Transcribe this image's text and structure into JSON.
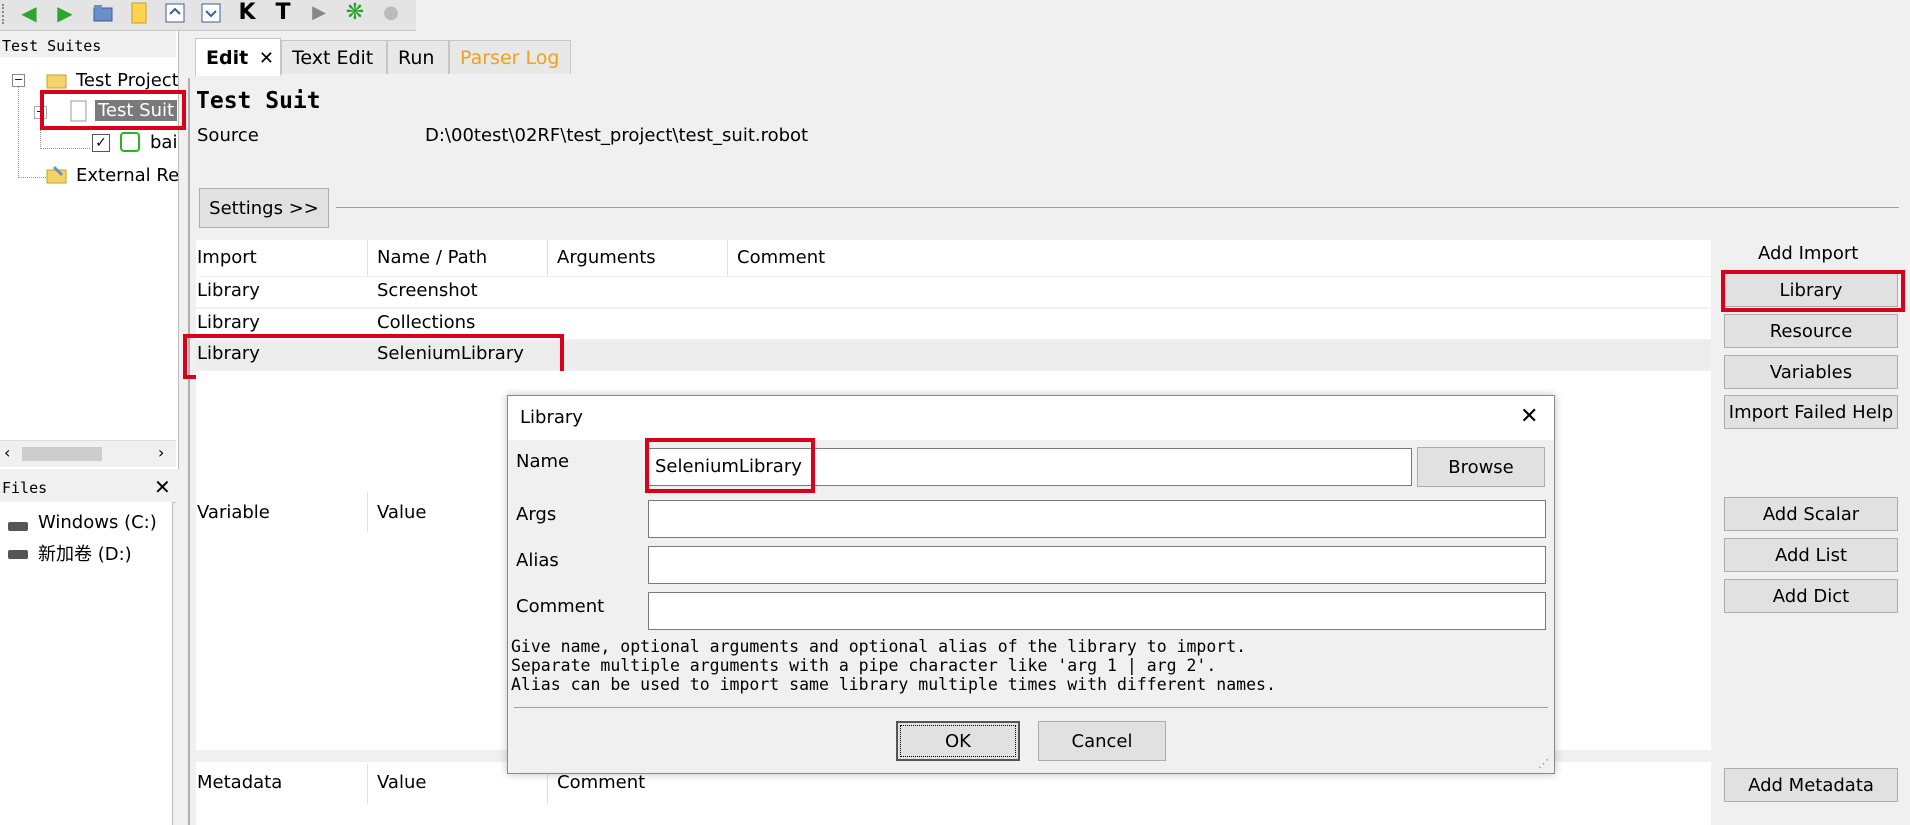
{
  "toolbar": {
    "icons": [
      "back-arrow-icon",
      "forward-arrow-icon",
      "open-folder-icon",
      "new-file-icon",
      "save-icon",
      "save-all-icon",
      "search-keywords-icon",
      "search-tests-icon",
      "run-icon",
      "debug-icon",
      "stop-icon"
    ],
    "k_glyph": "K",
    "t_glyph": "T"
  },
  "tree": {
    "title": "Test Suites",
    "project": "Test Project",
    "suite": "Test Suit",
    "test_case": "bai",
    "external": "External Resources"
  },
  "files": {
    "title": "Files",
    "drives": [
      "Windows (C:)",
      "新加卷 (D:)"
    ]
  },
  "tabs": [
    "Edit",
    "Text Edit",
    "Run",
    "Parser Log"
  ],
  "colors": {
    "accent_red": "#d9001b",
    "parser_log_tab": "#f0a020",
    "test_case_icon": "#26b526"
  },
  "editor": {
    "title": "Test Suit",
    "source_label": "Source",
    "source_path": "D:\\00test\\02RF\\test_project\\test_suit.robot",
    "settings_button": "Settings >>",
    "imports": {
      "headers": [
        "Import",
        "Name / Path",
        "Arguments",
        "Comment"
      ],
      "rows": [
        {
          "type": "Library",
          "name": "Screenshot"
        },
        {
          "type": "Library",
          "name": "Collections"
        },
        {
          "type": "Library",
          "name": "SeleniumLibrary"
        }
      ]
    },
    "add_import": {
      "label": "Add Import",
      "library": "Library",
      "resource": "Resource",
      "variables": "Variables",
      "import_failed_help": "Import Failed Help"
    },
    "variables": {
      "headers": [
        "Variable",
        "Value"
      ],
      "add_scalar": "Add Scalar",
      "add_list": "Add List",
      "add_dict": "Add Dict"
    },
    "metadata": {
      "headers": [
        "Metadata",
        "Value",
        "Comment"
      ],
      "add_metadata": "Add Metadata"
    }
  },
  "dialog": {
    "title": "Library",
    "name_label": "Name",
    "name_value": "SeleniumLibrary",
    "browse": "Browse",
    "args_label": "Args",
    "alias_label": "Alias",
    "comment_label": "Comment",
    "help_line1": "Give name, optional arguments and optional alias of the library to import.",
    "help_line2": "Separate multiple arguments with a pipe character like 'arg 1 | arg 2'.",
    "help_line3": "Alias can be used to import same library multiple times with different names.",
    "ok": "OK",
    "cancel": "Cancel"
  }
}
